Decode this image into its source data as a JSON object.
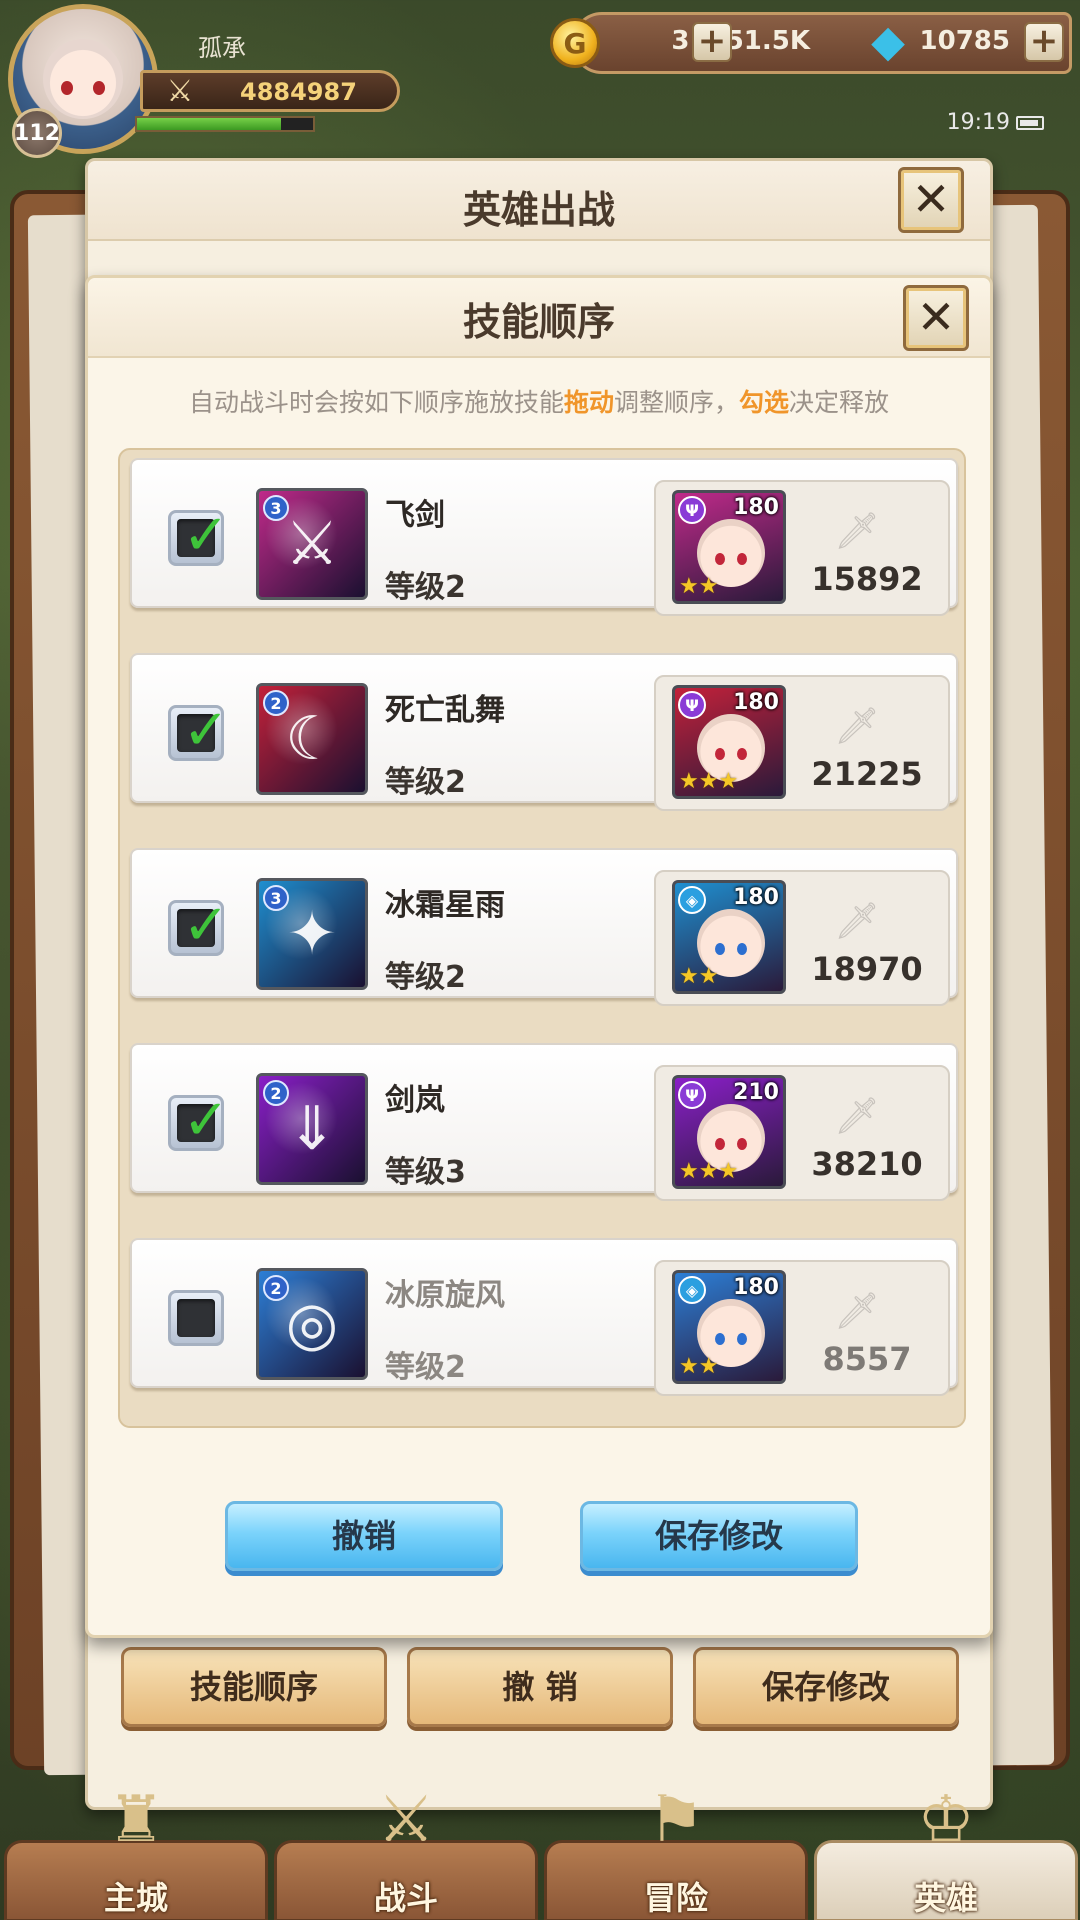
{
  "player": {
    "name": "孤承",
    "level": "112",
    "power": "4884987",
    "xp_fraction": 0.82
  },
  "resources": {
    "gold": "31451.5K",
    "gems": "10785",
    "plus": "+"
  },
  "status": {
    "time": "19:19"
  },
  "outer_dialog": {
    "title": "英雄出战",
    "close": "✕",
    "buttons": {
      "skill_order": "技能顺序",
      "undo": "撤 销",
      "save": "保存修改"
    }
  },
  "inner_dialog": {
    "title": "技能顺序",
    "close": "✕",
    "hint": {
      "part1": "自动战斗时会按如下顺序施放技能",
      "drag": "拖动",
      "part2": "调整顺序，",
      "check": "勾选",
      "part3": "决定释放"
    },
    "skills": [
      {
        "name": "飞剑",
        "level": "等级2",
        "badge": "3",
        "checked": true,
        "hero_level": "180",
        "hero_class": "purple",
        "stars": "★★",
        "power": "15892",
        "icon": "sword-icon",
        "color": "#c02a8a"
      },
      {
        "name": "死亡乱舞",
        "level": "等级2",
        "badge": "2",
        "checked": true,
        "hero_level": "180",
        "hero_class": "purple",
        "stars": "★★★",
        "power": "21225",
        "icon": "slash-icon",
        "color": "#c3213a"
      },
      {
        "name": "冰霜星雨",
        "level": "等级2",
        "badge": "3",
        "checked": true,
        "hero_level": "180",
        "hero_class": "blue",
        "stars": "★★",
        "power": "18970",
        "icon": "star-icon",
        "color": "#1f8fd0"
      },
      {
        "name": "剑岚",
        "level": "等级3",
        "badge": "2",
        "checked": true,
        "hero_level": "210",
        "hero_class": "purple",
        "stars": "★★★",
        "power": "38210",
        "icon": "blade-icon",
        "color": "#8a1fc8"
      },
      {
        "name": "冰原旋风",
        "level": "等级2",
        "badge": "2",
        "checked": false,
        "hero_level": "180",
        "hero_class": "blue",
        "stars": "★★",
        "power": "8557",
        "icon": "whirlwind-icon",
        "color": "#2d7fd6"
      }
    ],
    "buttons": {
      "undo": "撤销",
      "save": "保存修改"
    }
  },
  "nav": [
    {
      "label": "主城",
      "icon": "castle-icon"
    },
    {
      "label": "战斗",
      "icon": "crossed-swords-icon"
    },
    {
      "label": "冒险",
      "icon": "map-icon"
    },
    {
      "label": "英雄",
      "icon": "hero-icon"
    }
  ]
}
